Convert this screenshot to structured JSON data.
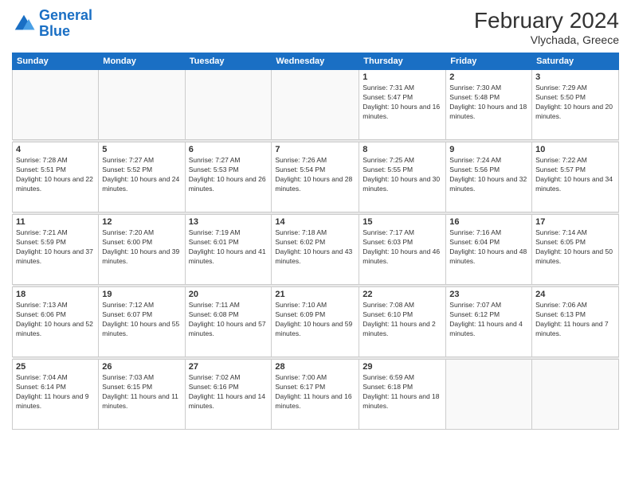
{
  "header": {
    "logo_line1": "General",
    "logo_line2": "Blue",
    "month_title": "February 2024",
    "location": "Vlychada, Greece"
  },
  "weekdays": [
    "Sunday",
    "Monday",
    "Tuesday",
    "Wednesday",
    "Thursday",
    "Friday",
    "Saturday"
  ],
  "weeks": [
    [
      {
        "day": "",
        "sunrise": "",
        "sunset": "",
        "daylight": ""
      },
      {
        "day": "",
        "sunrise": "",
        "sunset": "",
        "daylight": ""
      },
      {
        "day": "",
        "sunrise": "",
        "sunset": "",
        "daylight": ""
      },
      {
        "day": "",
        "sunrise": "",
        "sunset": "",
        "daylight": ""
      },
      {
        "day": "1",
        "sunrise": "Sunrise: 7:31 AM",
        "sunset": "Sunset: 5:47 PM",
        "daylight": "Daylight: 10 hours and 16 minutes."
      },
      {
        "day": "2",
        "sunrise": "Sunrise: 7:30 AM",
        "sunset": "Sunset: 5:48 PM",
        "daylight": "Daylight: 10 hours and 18 minutes."
      },
      {
        "day": "3",
        "sunrise": "Sunrise: 7:29 AM",
        "sunset": "Sunset: 5:50 PM",
        "daylight": "Daylight: 10 hours and 20 minutes."
      }
    ],
    [
      {
        "day": "4",
        "sunrise": "Sunrise: 7:28 AM",
        "sunset": "Sunset: 5:51 PM",
        "daylight": "Daylight: 10 hours and 22 minutes."
      },
      {
        "day": "5",
        "sunrise": "Sunrise: 7:27 AM",
        "sunset": "Sunset: 5:52 PM",
        "daylight": "Daylight: 10 hours and 24 minutes."
      },
      {
        "day": "6",
        "sunrise": "Sunrise: 7:27 AM",
        "sunset": "Sunset: 5:53 PM",
        "daylight": "Daylight: 10 hours and 26 minutes."
      },
      {
        "day": "7",
        "sunrise": "Sunrise: 7:26 AM",
        "sunset": "Sunset: 5:54 PM",
        "daylight": "Daylight: 10 hours and 28 minutes."
      },
      {
        "day": "8",
        "sunrise": "Sunrise: 7:25 AM",
        "sunset": "Sunset: 5:55 PM",
        "daylight": "Daylight: 10 hours and 30 minutes."
      },
      {
        "day": "9",
        "sunrise": "Sunrise: 7:24 AM",
        "sunset": "Sunset: 5:56 PM",
        "daylight": "Daylight: 10 hours and 32 minutes."
      },
      {
        "day": "10",
        "sunrise": "Sunrise: 7:22 AM",
        "sunset": "Sunset: 5:57 PM",
        "daylight": "Daylight: 10 hours and 34 minutes."
      }
    ],
    [
      {
        "day": "11",
        "sunrise": "Sunrise: 7:21 AM",
        "sunset": "Sunset: 5:59 PM",
        "daylight": "Daylight: 10 hours and 37 minutes."
      },
      {
        "day": "12",
        "sunrise": "Sunrise: 7:20 AM",
        "sunset": "Sunset: 6:00 PM",
        "daylight": "Daylight: 10 hours and 39 minutes."
      },
      {
        "day": "13",
        "sunrise": "Sunrise: 7:19 AM",
        "sunset": "Sunset: 6:01 PM",
        "daylight": "Daylight: 10 hours and 41 minutes."
      },
      {
        "day": "14",
        "sunrise": "Sunrise: 7:18 AM",
        "sunset": "Sunset: 6:02 PM",
        "daylight": "Daylight: 10 hours and 43 minutes."
      },
      {
        "day": "15",
        "sunrise": "Sunrise: 7:17 AM",
        "sunset": "Sunset: 6:03 PM",
        "daylight": "Daylight: 10 hours and 46 minutes."
      },
      {
        "day": "16",
        "sunrise": "Sunrise: 7:16 AM",
        "sunset": "Sunset: 6:04 PM",
        "daylight": "Daylight: 10 hours and 48 minutes."
      },
      {
        "day": "17",
        "sunrise": "Sunrise: 7:14 AM",
        "sunset": "Sunset: 6:05 PM",
        "daylight": "Daylight: 10 hours and 50 minutes."
      }
    ],
    [
      {
        "day": "18",
        "sunrise": "Sunrise: 7:13 AM",
        "sunset": "Sunset: 6:06 PM",
        "daylight": "Daylight: 10 hours and 52 minutes."
      },
      {
        "day": "19",
        "sunrise": "Sunrise: 7:12 AM",
        "sunset": "Sunset: 6:07 PM",
        "daylight": "Daylight: 10 hours and 55 minutes."
      },
      {
        "day": "20",
        "sunrise": "Sunrise: 7:11 AM",
        "sunset": "Sunset: 6:08 PM",
        "daylight": "Daylight: 10 hours and 57 minutes."
      },
      {
        "day": "21",
        "sunrise": "Sunrise: 7:10 AM",
        "sunset": "Sunset: 6:09 PM",
        "daylight": "Daylight: 10 hours and 59 minutes."
      },
      {
        "day": "22",
        "sunrise": "Sunrise: 7:08 AM",
        "sunset": "Sunset: 6:10 PM",
        "daylight": "Daylight: 11 hours and 2 minutes."
      },
      {
        "day": "23",
        "sunrise": "Sunrise: 7:07 AM",
        "sunset": "Sunset: 6:12 PM",
        "daylight": "Daylight: 11 hours and 4 minutes."
      },
      {
        "day": "24",
        "sunrise": "Sunrise: 7:06 AM",
        "sunset": "Sunset: 6:13 PM",
        "daylight": "Daylight: 11 hours and 7 minutes."
      }
    ],
    [
      {
        "day": "25",
        "sunrise": "Sunrise: 7:04 AM",
        "sunset": "Sunset: 6:14 PM",
        "daylight": "Daylight: 11 hours and 9 minutes."
      },
      {
        "day": "26",
        "sunrise": "Sunrise: 7:03 AM",
        "sunset": "Sunset: 6:15 PM",
        "daylight": "Daylight: 11 hours and 11 minutes."
      },
      {
        "day": "27",
        "sunrise": "Sunrise: 7:02 AM",
        "sunset": "Sunset: 6:16 PM",
        "daylight": "Daylight: 11 hours and 14 minutes."
      },
      {
        "day": "28",
        "sunrise": "Sunrise: 7:00 AM",
        "sunset": "Sunset: 6:17 PM",
        "daylight": "Daylight: 11 hours and 16 minutes."
      },
      {
        "day": "29",
        "sunrise": "Sunrise: 6:59 AM",
        "sunset": "Sunset: 6:18 PM",
        "daylight": "Daylight: 11 hours and 18 minutes."
      },
      {
        "day": "",
        "sunrise": "",
        "sunset": "",
        "daylight": ""
      },
      {
        "day": "",
        "sunrise": "",
        "sunset": "",
        "daylight": ""
      }
    ]
  ]
}
